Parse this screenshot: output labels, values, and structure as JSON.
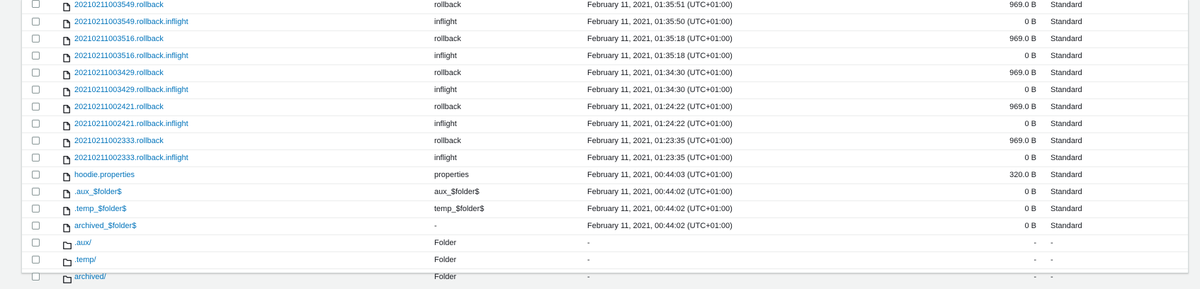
{
  "objects": [
    {
      "name": "20210211003549.rollback",
      "type": "rollback",
      "last_modified": "February 11, 2021, 01:35:51 (UTC+01:00)",
      "size": "969.0 B",
      "storage_class": "Standard",
      "kind": "file"
    },
    {
      "name": "20210211003549.rollback.inflight",
      "type": "inflight",
      "last_modified": "February 11, 2021, 01:35:50 (UTC+01:00)",
      "size": "0 B",
      "storage_class": "Standard",
      "kind": "file"
    },
    {
      "name": "20210211003516.rollback",
      "type": "rollback",
      "last_modified": "February 11, 2021, 01:35:18 (UTC+01:00)",
      "size": "969.0 B",
      "storage_class": "Standard",
      "kind": "file"
    },
    {
      "name": "20210211003516.rollback.inflight",
      "type": "inflight",
      "last_modified": "February 11, 2021, 01:35:18 (UTC+01:00)",
      "size": "0 B",
      "storage_class": "Standard",
      "kind": "file"
    },
    {
      "name": "20210211003429.rollback",
      "type": "rollback",
      "last_modified": "February 11, 2021, 01:34:30 (UTC+01:00)",
      "size": "969.0 B",
      "storage_class": "Standard",
      "kind": "file"
    },
    {
      "name": "20210211003429.rollback.inflight",
      "type": "inflight",
      "last_modified": "February 11, 2021, 01:34:30 (UTC+01:00)",
      "size": "0 B",
      "storage_class": "Standard",
      "kind": "file"
    },
    {
      "name": "20210211002421.rollback",
      "type": "rollback",
      "last_modified": "February 11, 2021, 01:24:22 (UTC+01:00)",
      "size": "969.0 B",
      "storage_class": "Standard",
      "kind": "file"
    },
    {
      "name": "20210211002421.rollback.inflight",
      "type": "inflight",
      "last_modified": "February 11, 2021, 01:24:22 (UTC+01:00)",
      "size": "0 B",
      "storage_class": "Standard",
      "kind": "file"
    },
    {
      "name": "20210211002333.rollback",
      "type": "rollback",
      "last_modified": "February 11, 2021, 01:23:35 (UTC+01:00)",
      "size": "969.0 B",
      "storage_class": "Standard",
      "kind": "file"
    },
    {
      "name": "20210211002333.rollback.inflight",
      "type": "inflight",
      "last_modified": "February 11, 2021, 01:23:35 (UTC+01:00)",
      "size": "0 B",
      "storage_class": "Standard",
      "kind": "file"
    },
    {
      "name": "hoodie.properties",
      "type": "properties",
      "last_modified": "February 11, 2021, 00:44:03 (UTC+01:00)",
      "size": "320.0 B",
      "storage_class": "Standard",
      "kind": "file"
    },
    {
      "name": ".aux_$folder$",
      "type": "aux_$folder$",
      "last_modified": "February 11, 2021, 00:44:02 (UTC+01:00)",
      "size": "0 B",
      "storage_class": "Standard",
      "kind": "file"
    },
    {
      "name": ".temp_$folder$",
      "type": "temp_$folder$",
      "last_modified": "February 11, 2021, 00:44:02 (UTC+01:00)",
      "size": "0 B",
      "storage_class": "Standard",
      "kind": "file"
    },
    {
      "name": "archived_$folder$",
      "type": "-",
      "last_modified": "February 11, 2021, 00:44:02 (UTC+01:00)",
      "size": "0 B",
      "storage_class": "Standard",
      "kind": "file"
    },
    {
      "name": ".aux/",
      "type": "Folder",
      "last_modified": "-",
      "size": "-",
      "storage_class": "-",
      "kind": "folder"
    },
    {
      "name": ".temp/",
      "type": "Folder",
      "last_modified": "-",
      "size": "-",
      "storage_class": "-",
      "kind": "folder"
    },
    {
      "name": "archived/",
      "type": "Folder",
      "last_modified": "-",
      "size": "-",
      "storage_class": "-",
      "kind": "folder"
    }
  ],
  "icons": {
    "file": "file-icon",
    "folder": "folder-icon"
  },
  "colors": {
    "link": "#0073bb",
    "text": "#16191f",
    "border": "#eaeded",
    "background": "#f2f3f3"
  }
}
